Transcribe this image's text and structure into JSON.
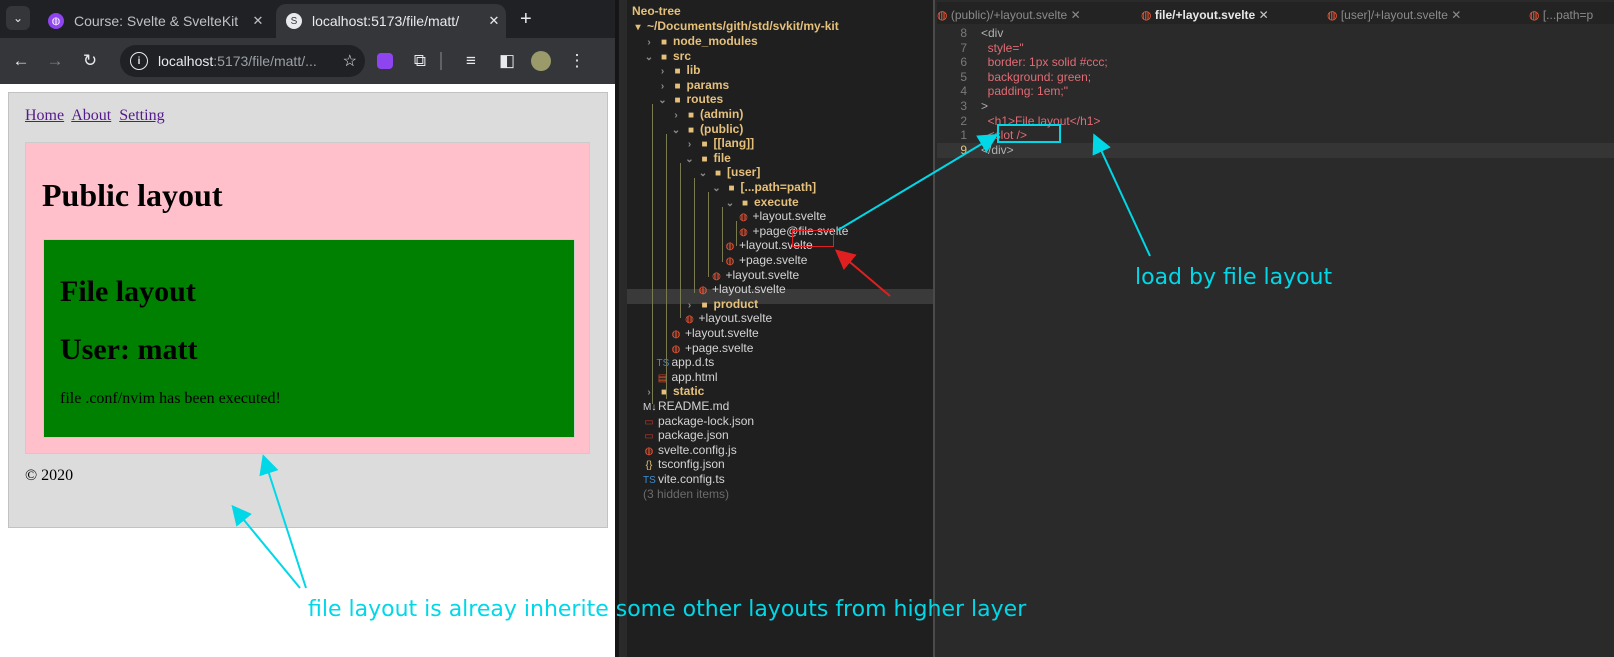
{
  "browser": {
    "tabs": [
      {
        "title": "Course: Svelte & SvelteKit",
        "close": "✕"
      },
      {
        "title": "localhost:5173/file/matt/",
        "close": "✕"
      }
    ],
    "new_tab": "+",
    "omnibox": {
      "host": "localhost",
      "path": ":5173/file/matt/..."
    },
    "page": {
      "nav": [
        "Home",
        "About",
        "Setting"
      ],
      "public_heading": "Public layout",
      "file_heading": "File layout",
      "user_heading": "User: matt",
      "message": "file .conf/nvim has been executed!",
      "footer": "© 2020"
    },
    "colors": {
      "public_bg": "#ffc0cb",
      "file_bg": "#008000",
      "annotation": "#00d8e8"
    }
  },
  "tree": {
    "title": "Neo-tree",
    "root": "~/Documents/gith/std/svkit/my-kit",
    "items": [
      {
        "label": "node_modules",
        "type": "dir",
        "chevron": "›"
      },
      {
        "label": "src",
        "type": "dir-open",
        "chevron": "⌄"
      },
      {
        "label": "lib",
        "type": "dir",
        "chevron": "›"
      },
      {
        "label": "params",
        "type": "dir",
        "chevron": "›"
      },
      {
        "label": "routes",
        "type": "dir-open",
        "chevron": "⌄"
      },
      {
        "label": "(admin)",
        "type": "dir",
        "chevron": "›"
      },
      {
        "label": "(public)",
        "type": "dir-open",
        "chevron": "⌄"
      },
      {
        "label": "[[lang]]",
        "type": "dir",
        "chevron": "›"
      },
      {
        "label": "file",
        "type": "dir-open",
        "chevron": "⌄"
      },
      {
        "label": "[user]",
        "type": "dir-open",
        "chevron": "⌄"
      },
      {
        "label": "[...path=path]",
        "type": "dir-open",
        "chevron": "⌄"
      },
      {
        "label": "execute",
        "type": "dir-open",
        "chevron": "⌄"
      },
      {
        "label": "+layout.svelte",
        "type": "svelte"
      },
      {
        "label": "+page@file.svelte",
        "type": "svelte"
      },
      {
        "label": "+layout.svelte",
        "type": "svelte"
      },
      {
        "label": "+page.svelte",
        "type": "svelte"
      },
      {
        "label": "+layout.svelte",
        "type": "svelte"
      },
      {
        "label": "+layout.svelte",
        "type": "svelte"
      },
      {
        "label": "product",
        "type": "dir",
        "chevron": "›"
      },
      {
        "label": "+layout.svelte",
        "type": "svelte"
      },
      {
        "label": "+layout.svelte",
        "type": "svelte"
      },
      {
        "label": "+page.svelte",
        "type": "svelte"
      },
      {
        "label": "app.d.ts",
        "type": "ts"
      },
      {
        "label": "app.html",
        "type": "html"
      },
      {
        "label": "static",
        "type": "dir",
        "chevron": "›"
      },
      {
        "label": "README.md",
        "type": "md"
      },
      {
        "label": "package-lock.json",
        "type": "json"
      },
      {
        "label": "package.json",
        "type": "json"
      },
      {
        "label": "svelte.config.js",
        "type": "svelte"
      },
      {
        "label": "tsconfig.json",
        "type": "braces"
      },
      {
        "label": "vite.config.ts",
        "type": "ts"
      },
      {
        "label": "(3 hidden items)",
        "type": "hidden"
      }
    ]
  },
  "editor_tabs": [
    {
      "label": "(public)/+layout.svelte",
      "close": "✕"
    },
    {
      "label": "file/+layout.svelte",
      "close": "✕"
    },
    {
      "label": "[user]/+layout.svelte",
      "close": "✕"
    },
    {
      "label": "[...path=p",
      "close": ""
    }
  ],
  "code": {
    "lines": [
      {
        "n": "8",
        "text": "<div"
      },
      {
        "n": "7",
        "text": "  style=\""
      },
      {
        "n": "6",
        "text": "  border: 1px solid #ccc;"
      },
      {
        "n": "5",
        "text": "  background: green;"
      },
      {
        "n": "4",
        "text": "  padding: 1em;\""
      },
      {
        "n": "3",
        "text": ">"
      },
      {
        "n": "2",
        "text": "  <h1>File layout</h1>"
      },
      {
        "n": "1",
        "text": "  <slot />"
      },
      {
        "n": "9",
        "text": "</div>"
      }
    ]
  },
  "annotations": {
    "load_by": "load by file layout",
    "inherit": "file layout is alreay inherite some other layouts from higher layer"
  }
}
